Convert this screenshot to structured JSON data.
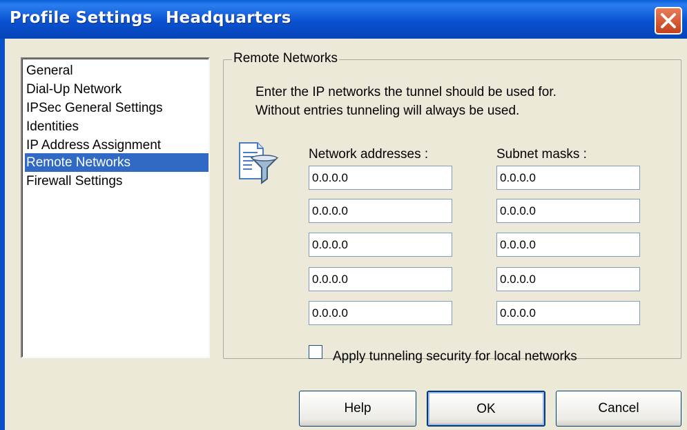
{
  "window": {
    "title": "Profile Settings",
    "profile_name": "Headquarters",
    "close_icon": "close-icon"
  },
  "nav": {
    "items": [
      "General",
      "Dial-Up Network",
      "IPSec General Settings",
      "Identities",
      "IP Address Assignment",
      "Remote Networks",
      "Firewall Settings"
    ],
    "selected": "Remote Networks",
    "selected_color": "#316ac5"
  },
  "panel": {
    "legend": "Remote Networks",
    "description_line1": "Enter the IP networks the tunnel should be used for.",
    "description_line2": "Without entries tunneling will always be used.",
    "icon": "network-filter-icon",
    "network_header": "Network addresses :",
    "subnet_header": "Subnet masks :",
    "network_addresses": [
      "0.0.0.0",
      "0.0.0.0",
      "0.0.0.0",
      "0.0.0.0",
      "0.0.0.0"
    ],
    "subnet_masks": [
      "0.0.0.0",
      "0.0.0.0",
      "0.0.0.0",
      "0.0.0.0",
      "0.0.0.0"
    ],
    "checkbox_label": "Apply tunneling security for local networks",
    "checkbox_checked": false
  },
  "buttons": {
    "help": "Help",
    "ok": "OK",
    "cancel": "Cancel"
  },
  "colors": {
    "titlebar": "#0a52d0",
    "dialog_bg": "#ece9d8",
    "close_button": "#d85a32"
  }
}
